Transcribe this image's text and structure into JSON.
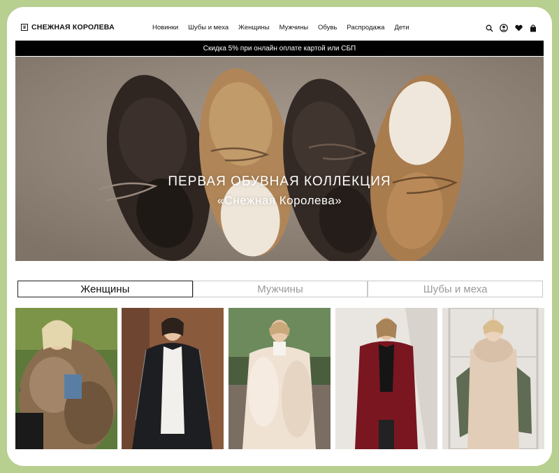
{
  "brand": {
    "name": "СНЕЖНАЯ КОРОЛЕВА"
  },
  "nav": {
    "items": [
      "Новинки",
      "Шубы и меха",
      "Женщины",
      "Мужчины",
      "Обувь",
      "Распродажа",
      "Дети"
    ]
  },
  "header_icons": [
    "search-icon",
    "account-icon",
    "heart-icon",
    "bag-icon"
  ],
  "promo": {
    "text": "Скидка 5% при онлайн оплате картой или СБП"
  },
  "hero": {
    "title": "ПЕРВАЯ ОБУВНАЯ КОЛЛЕКЦИЯ",
    "subtitle": "«Снежная Королева»"
  },
  "tabs": [
    {
      "label": "Женщины",
      "active": true
    },
    {
      "label": "Мужчины",
      "active": false
    },
    {
      "label": "Шубы и меха",
      "active": false
    }
  ],
  "products": [
    {
      "photo": "woman-fur-coat-brown"
    },
    {
      "photo": "woman-black-leather-coat"
    },
    {
      "photo": "woman-cream-fur-coat"
    },
    {
      "photo": "woman-burgundy-coat"
    },
    {
      "photo": "woman-knit-vest-leopard"
    }
  ],
  "colors": {
    "promo_bg": "#000000",
    "page_bg": "#b7cf8f",
    "accent": "#111111"
  }
}
